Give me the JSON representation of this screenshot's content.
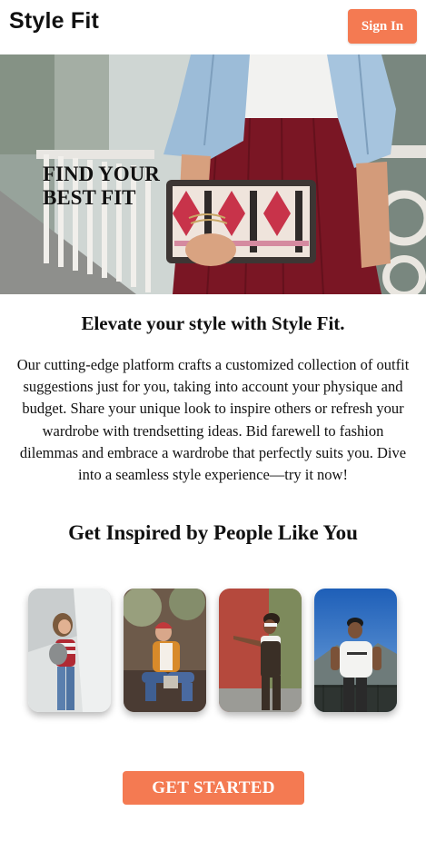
{
  "header": {
    "brand": "Style Fit",
    "sign_in_label": "Sign In"
  },
  "hero": {
    "headline_line1": "FIND YOUR",
    "headline_line2": "BEST FIT"
  },
  "intro": {
    "tagline": "Elevate your style with Style Fit.",
    "description": "Our cutting-edge platform crafts a customized collection of outfit suggestions just for you, taking into account your physique and budget. Share your unique look to inspire others or refresh your wardrobe with trendsetting ideas. Bid farewell to fashion dilemmas and embrace a wardrobe that perfectly suits you. Dive into a seamless style experience—try it now!"
  },
  "inspiration": {
    "title": "Get Inspired by People Like You"
  },
  "cta": {
    "label": "GET STARTED"
  },
  "colors": {
    "accent": "#f47a52",
    "text": "#111111",
    "background": "#ffffff"
  }
}
